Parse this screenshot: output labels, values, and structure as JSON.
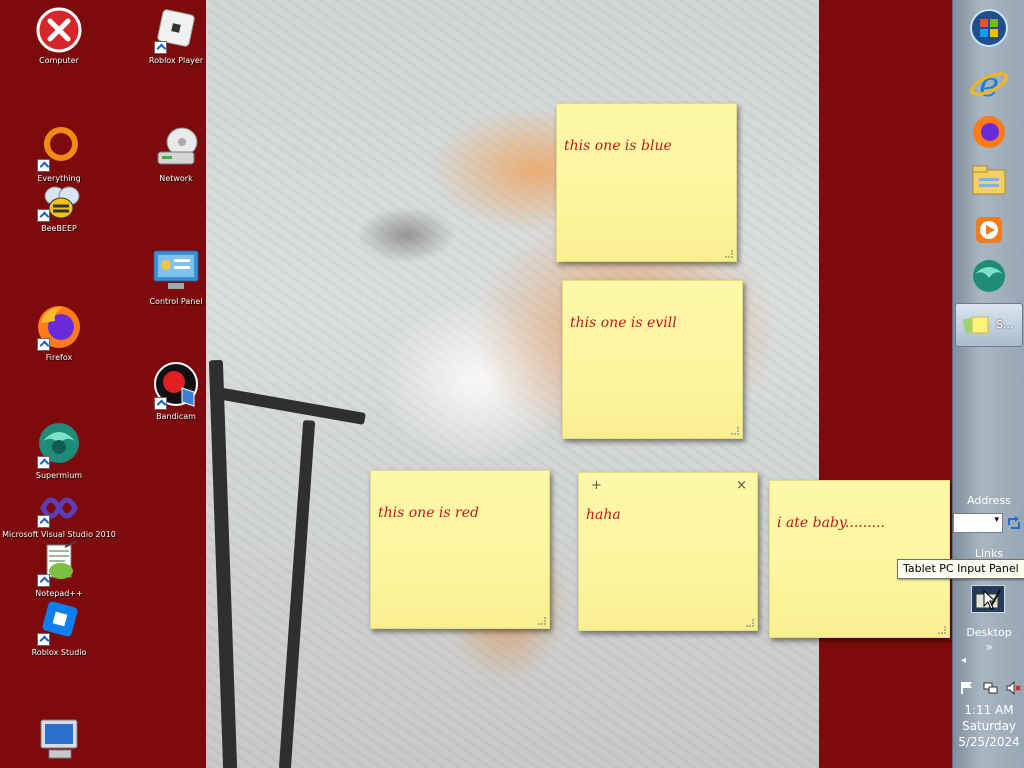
{
  "desktop_icons": [
    {
      "id": "computer",
      "label": "Computer",
      "icon": "computer-error-icon"
    },
    {
      "id": "roblox-player",
      "label": "Roblox Player",
      "icon": "roblox-icon"
    },
    {
      "id": "everything",
      "label": "Everything",
      "icon": "everything-search-icon"
    },
    {
      "id": "network",
      "label": "Network",
      "icon": "network-drive-icon"
    },
    {
      "id": "beebeep",
      "label": "BeeBEEP",
      "icon": "bee-icon"
    },
    {
      "id": "control-panel",
      "label": "Control Panel",
      "icon": "control-panel-icon"
    },
    {
      "id": "firefox",
      "label": "Firefox",
      "icon": "firefox-icon"
    },
    {
      "id": "bandicam",
      "label": "Bandicam",
      "icon": "bandicam-icon"
    },
    {
      "id": "supermium",
      "label": "Supermium",
      "icon": "supermium-icon"
    },
    {
      "id": "visual-studio",
      "label": "Microsoft Visual Studio 2010",
      "icon": "visual-studio-icon"
    },
    {
      "id": "notepadpp",
      "label": "Notepad++",
      "icon": "notepadpp-icon"
    },
    {
      "id": "roblox-studio",
      "label": "Roblox Studio",
      "icon": "roblox-studio-icon"
    },
    {
      "id": "recycle",
      "label": "",
      "icon": "monitor-icon"
    }
  ],
  "sticky_notes": [
    {
      "text": "this one is blue"
    },
    {
      "text": "this one is evill"
    },
    {
      "text": "this one is red"
    },
    {
      "text": "haha",
      "add_label": "+",
      "close_label": "×"
    },
    {
      "text": "i ate baby........."
    }
  ],
  "taskbar": {
    "pinned": [
      "start-orb-icon",
      "internet-explorer-icon",
      "firefox-icon",
      "explorer-folder-icon",
      "media-player-icon",
      "supermium-icon"
    ],
    "active_task_label": "S...",
    "address_label": "Address",
    "links_label": "Links",
    "desktop_label": "Desktop",
    "desktop_chevron": "»",
    "tray_arrow": "◂",
    "clock": {
      "time": "1:11 AM",
      "day": "Saturday",
      "date": "5/25/2024"
    }
  },
  "tooltip": {
    "text": "Tablet PC Input Panel"
  }
}
